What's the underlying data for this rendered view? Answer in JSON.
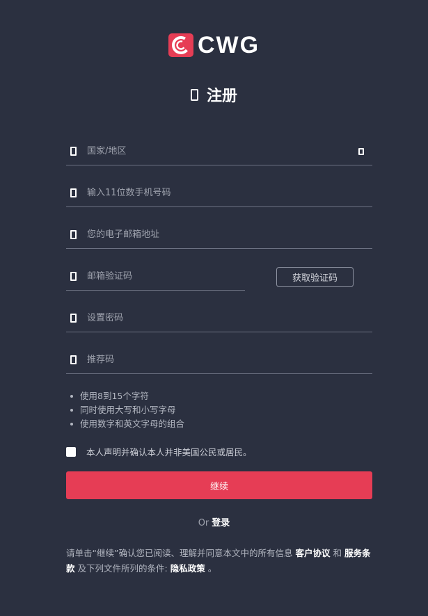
{
  "brand": {
    "name": "CWG",
    "accent_color": "#e63d55"
  },
  "page_title": "注册",
  "fields": {
    "country": {
      "placeholder": "国家/地区"
    },
    "phone": {
      "placeholder": "输入11位数手机号码"
    },
    "email": {
      "placeholder": "您的电子邮箱地址"
    },
    "email_code": {
      "placeholder": "邮箱验证码"
    },
    "password": {
      "placeholder": "设置密码"
    },
    "referral": {
      "placeholder": "推荐码"
    }
  },
  "get_code_label": "获取验证码",
  "password_rules": [
    "使用8到15个字符",
    "同时使用大写和小写字母",
    "使用数字和英文字母的组合"
  ],
  "consent_text": "本人声明并确认本人并非美国公民或居民。",
  "continue_label": "继续",
  "or_text": "Or",
  "login_label": "登录",
  "terms": {
    "prefix": "请单击“继续”确认您已阅读、理解并同意本文中的所有信息",
    "customer_agreement": "客户协议",
    "and": "和",
    "service_terms": "服务条款",
    "middle": "及下列文件所列的条件:",
    "privacy_policy": "隐私政策",
    "suffix": "。"
  }
}
